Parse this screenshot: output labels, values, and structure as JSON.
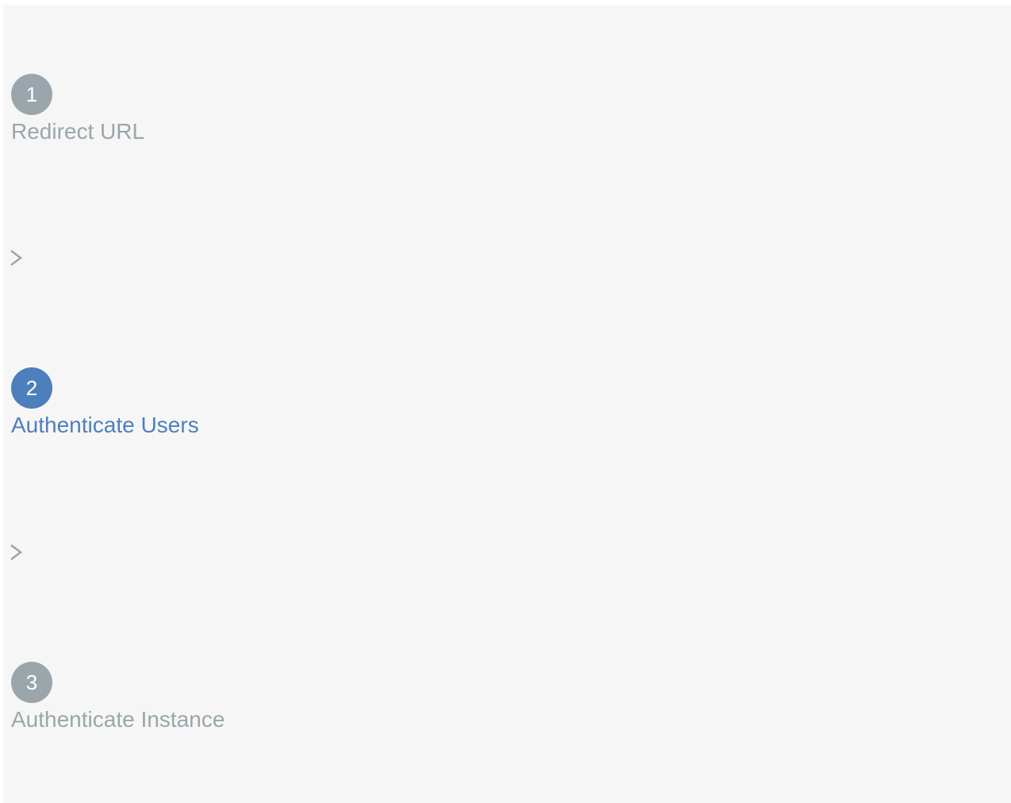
{
  "stepper": {
    "steps": [
      {
        "number": "1",
        "label": "Redirect URL",
        "state": "inactive"
      },
      {
        "number": "2",
        "label": "Authenticate Users",
        "state": "active"
      },
      {
        "number": "3",
        "label": "Authenticate Instance",
        "state": "inactive"
      }
    ],
    "separator_icon": "chevron-right-icon"
  },
  "colors": {
    "background": "#f6f6f6",
    "inactive": "#9aa6ab",
    "active": "#4e7fbd"
  }
}
